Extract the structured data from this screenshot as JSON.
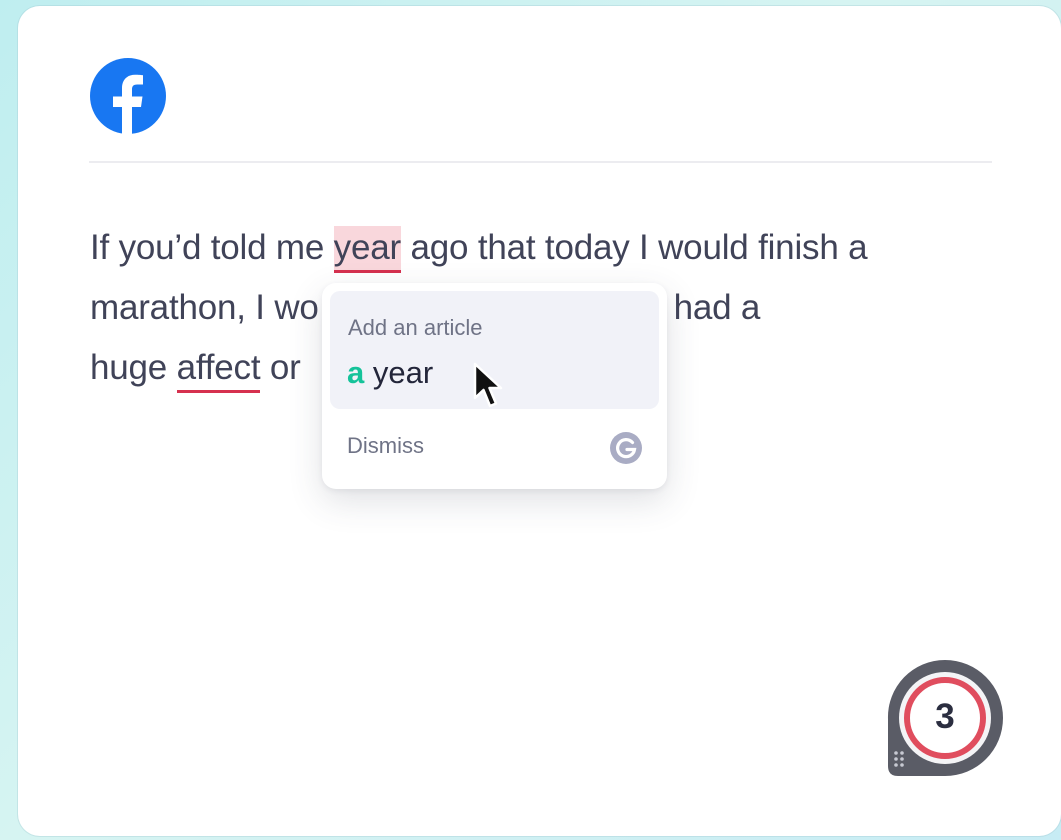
{
  "post": {
    "lines": [
      [
        "If you’d told me ",
        "year",
        " ago that today I would finish a"
      ],
      [
        "marathon, I wo",
        "",
        " support had a"
      ],
      [
        "huge ",
        "affect",
        " or"
      ]
    ],
    "line1_before": "If you’d told me ",
    "line1_flag": "year",
    "line1_after": " ago that today I would finish a",
    "line2_before": "marathon, I wo",
    "line2_after": "support had a",
    "line3_before": "huge ",
    "line3_flag": "affect",
    "line3_after": " or"
  },
  "popup": {
    "heading": "Add an article",
    "insert": "a",
    "word": " year",
    "dismiss": "Dismiss"
  },
  "widget": {
    "count": "3"
  },
  "icons": {
    "brand": "facebook-logo-icon",
    "assistant": "grammarly-g-icon",
    "pointer": "mouse-cursor-icon",
    "handle": "drag-handle-icon"
  },
  "colors": {
    "facebook_blue": "#1877f2",
    "error_underline": "#d6314f",
    "error_highlight": "#f9d7dc",
    "insert_green": "#15c39a",
    "text": "#404358"
  }
}
